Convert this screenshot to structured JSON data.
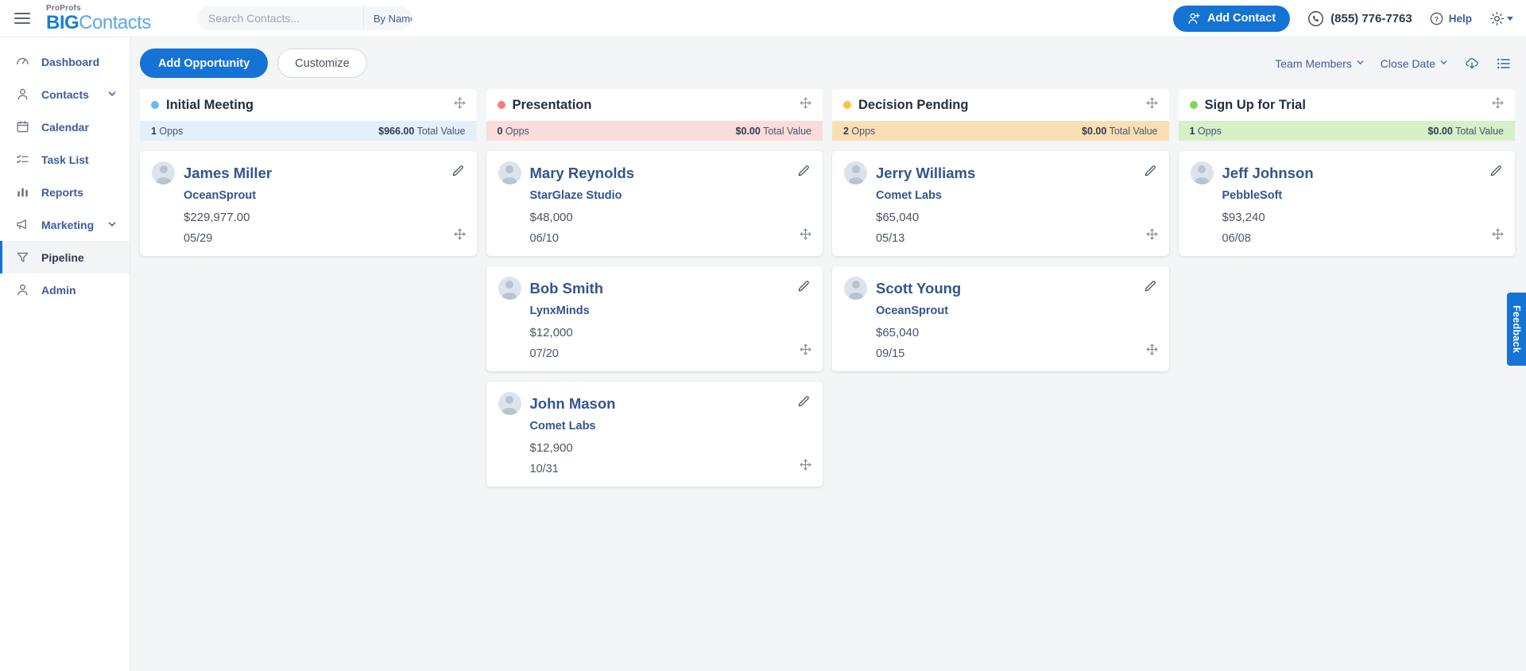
{
  "header": {
    "logo_pro": "ProProfs",
    "logo_big": "BIG",
    "logo_contacts": "Contacts",
    "search_placeholder": "Search Contacts...",
    "search_value": "",
    "search_by": "By Name",
    "add_contact_label": "Add Contact",
    "phone": "(855) 776-7763",
    "help_label": "Help"
  },
  "sidebar": {
    "items": [
      {
        "label": "Dashboard",
        "icon": "speedometer-icon",
        "expandable": false,
        "active": false
      },
      {
        "label": "Contacts",
        "icon": "person-icon",
        "expandable": true,
        "active": false
      },
      {
        "label": "Calendar",
        "icon": "calendar-icon",
        "expandable": false,
        "active": false
      },
      {
        "label": "Task List",
        "icon": "checklist-icon",
        "expandable": false,
        "active": false
      },
      {
        "label": "Reports",
        "icon": "bar-chart-icon",
        "expandable": false,
        "active": false
      },
      {
        "label": "Marketing",
        "icon": "megaphone-icon",
        "expandable": true,
        "active": false
      },
      {
        "label": "Pipeline",
        "icon": "funnel-icon",
        "expandable": false,
        "active": true
      },
      {
        "label": "Admin",
        "icon": "person-icon",
        "expandable": false,
        "active": false
      }
    ]
  },
  "toolbar": {
    "add_opportunity_label": "Add Opportunity",
    "customize_label": "Customize",
    "team_members_label": "Team Members",
    "close_date_label": "Close Date"
  },
  "board": {
    "columns": [
      {
        "title": "Initial Meeting",
        "dot_color": "#6bb9f0",
        "stats_bg": "#e3f0fb",
        "opps": "1 Opps",
        "opps_count": "1",
        "total_value": "$966.00",
        "total_value_label": "Total Value",
        "cards": [
          {
            "name": "James Miller",
            "company": "OceanSprout",
            "amount": "$229,977.00",
            "date": "05/29"
          }
        ]
      },
      {
        "title": "Presentation",
        "dot_color": "#fa7a7a",
        "stats_bg": "#fbdcdc",
        "opps": "0 Opps",
        "opps_count": "0",
        "total_value": "$0.00",
        "total_value_label": "Total Value",
        "cards": [
          {
            "name": "Mary Reynolds",
            "company": "StarGlaze Studio",
            "amount": "$48,000",
            "date": "06/10"
          },
          {
            "name": "Bob Smith",
            "company": "LynxMinds",
            "amount": "$12,000",
            "date": "07/20"
          },
          {
            "name": "John Mason",
            "company": "Comet Labs",
            "amount": "$12,900",
            "date": "10/31"
          }
        ]
      },
      {
        "title": "Decision Pending",
        "dot_color": "#fcc043",
        "stats_bg": "#fbdfb4",
        "opps": "2 Opps",
        "opps_count": "2",
        "total_value": "$0.00",
        "total_value_label": "Total Value",
        "cards": [
          {
            "name": "Jerry Williams",
            "company": "Comet Labs",
            "amount": "$65,040",
            "date": "05/13"
          },
          {
            "name": "Scott Young",
            "company": "OceanSprout",
            "amount": "$65,040",
            "date": "09/15"
          }
        ]
      },
      {
        "title": "Sign Up for Trial",
        "dot_color": "#7ed957",
        "stats_bg": "#d6f0c8",
        "opps": "1 Opps",
        "opps_count": "1",
        "total_value": "$0.00",
        "total_value_label": "Total Value",
        "cards": [
          {
            "name": "Jeff Johnson",
            "company": "PebbleSoft",
            "amount": "$93,240",
            "date": "06/08"
          }
        ]
      }
    ]
  },
  "feedback": {
    "label": "Feedback"
  },
  "colors": {
    "accent": "#1573d6",
    "link": "#3e5c9a",
    "card_name": "#33558e"
  }
}
